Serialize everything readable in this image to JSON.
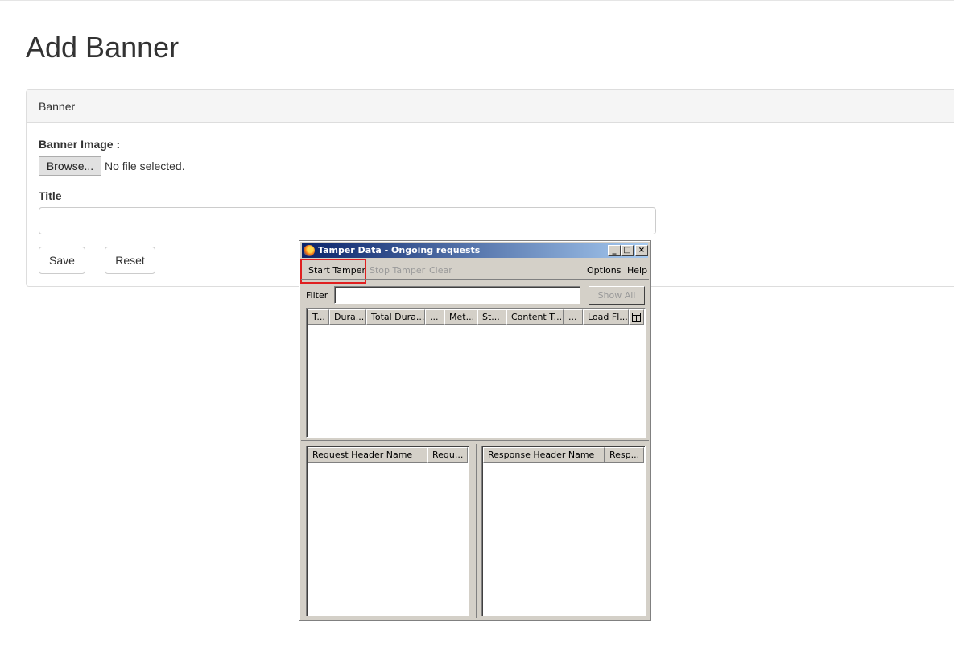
{
  "page": {
    "title": "Add Banner"
  },
  "panel": {
    "heading": "Banner",
    "banner_image_label": "Banner Image :",
    "browse_label": "Browse...",
    "no_file_text": "No file selected.",
    "title_label": "Title",
    "title_value": "",
    "save_label": "Save",
    "reset_label": "Reset"
  },
  "tamper": {
    "window_title": "Tamper Data - Ongoing requests",
    "controls": {
      "minimize": "_",
      "maximize": "□",
      "close": "×"
    },
    "toolbar": {
      "start": "Start Tamper",
      "stop": "Stop Tamper",
      "clear": "Clear",
      "options": "Options",
      "help": "Help"
    },
    "filter_label": "Filter",
    "filter_value": "",
    "show_all": "Show All",
    "columns": [
      "T...",
      "Dura...",
      "Total Dura...",
      "...",
      "Met...",
      "St...",
      "Content T...",
      "...",
      "Load Fl..."
    ],
    "request_columns": [
      "Request Header Name",
      "Requ..."
    ],
    "response_columns": [
      "Response Header Name",
      "Resp..."
    ],
    "highlight_color": "#e02020"
  }
}
